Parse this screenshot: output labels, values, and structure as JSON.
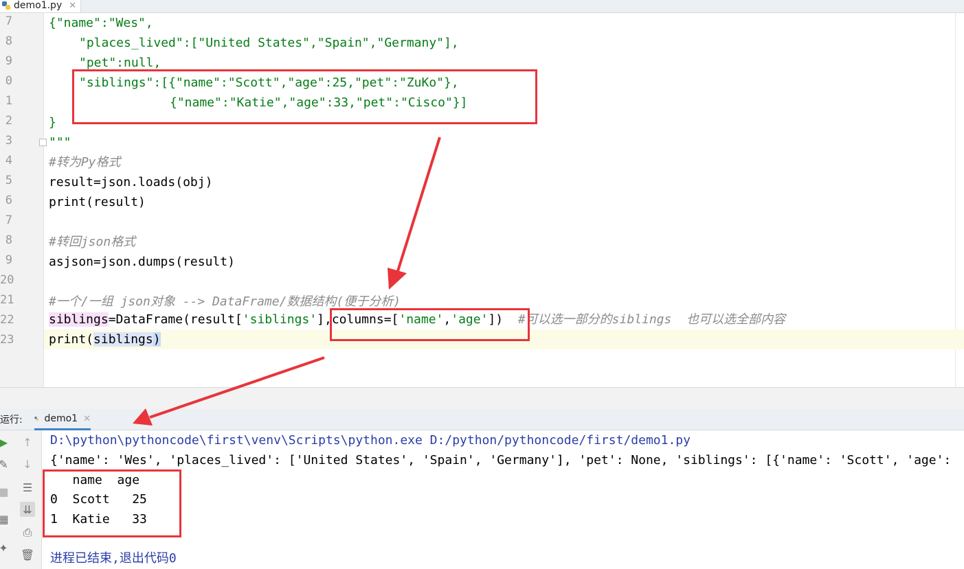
{
  "editor_tab": {
    "filename": "demo1.py"
  },
  "gutter": {
    "line_numbers": [
      "7",
      "8",
      "9",
      "0",
      "1",
      "2",
      "3",
      "4",
      "5",
      "6",
      "7",
      "8",
      "9",
      "20",
      "21",
      "22",
      "23"
    ]
  },
  "code": {
    "l7": {
      "a": "{\"name\":\"Wes\","
    },
    "l8": {
      "a": "\"places_lived\":[\"United States\",\"Spain\",\"Germany\"],"
    },
    "l9": {
      "a": "\"pet\":",
      "b": "null",
      "c": ","
    },
    "l10": {
      "a": "\"siblings\":[{\"name\":\"Scott\",\"age\":25,\"pet\":\"ZuKo\"},"
    },
    "l11": {
      "a": "{\"name\":\"Katie\",\"age\":33,\"pet\":\"Cisco\"}]"
    },
    "l12": {
      "a": "}"
    },
    "l13": {
      "a": "\"\"\""
    },
    "l14": {
      "comment": "#转为Py格式"
    },
    "l15": {
      "a": "result=json.loads(obj)"
    },
    "l16": {
      "a": "print(result)"
    },
    "l18": {
      "comment": "#转回json格式"
    },
    "l19": {
      "a": "asjson=json.dumps(result)"
    },
    "l21": {
      "comment": "#一个/一组 json对象 --> DataFrame/数据结构(便于分析)"
    },
    "l22": {
      "var": "siblings",
      "a": "=DataFrame(result[",
      "s1": "'siblings'",
      "b": "],columns=[",
      "s2": "'name'",
      "c": ",",
      "s3": "'age'",
      "d": "])",
      "comment": "#可以选一部分的siblings  也可以选全部内容"
    },
    "l23": {
      "a": "print(",
      "arg": "siblings",
      "b": ")"
    }
  },
  "run_panel": {
    "label": "运行:",
    "tab": "demo1",
    "command": "D:\\python\\pythoncode\\first\\venv\\Scripts\\python.exe D:/python/pythoncode/first/demo1.py",
    "dict_output": "{'name': 'Wes', 'places_lived': ['United States', 'Spain', 'Germany'], 'pet': None, 'siblings': [{'name': 'Scott', 'age':",
    "df_header": "   name  age",
    "df_row0": "0  Scott   25",
    "df_row1": "1  Katie   33",
    "exit_message": "进程已结束,退出代码0"
  },
  "colors": {
    "annotation": "#e8343a",
    "string": "#067d17",
    "comment": "#8c8c8c",
    "keyword": "#0033b3"
  }
}
